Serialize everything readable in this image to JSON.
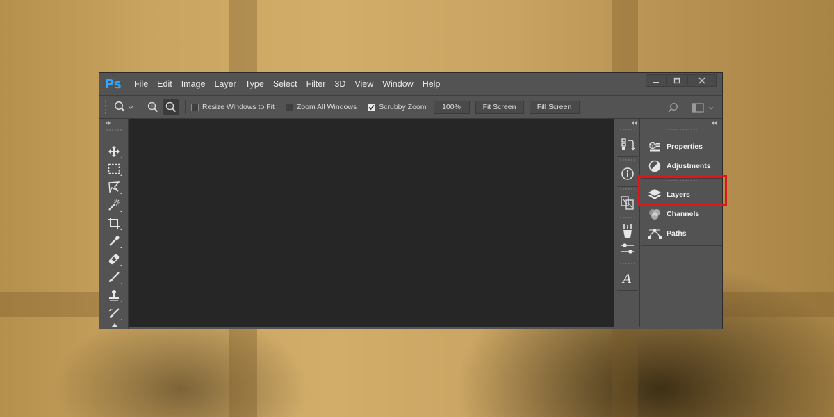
{
  "app": {
    "logo": "Ps",
    "menu": [
      "File",
      "Edit",
      "Image",
      "Layer",
      "Type",
      "Select",
      "Filter",
      "3D",
      "View",
      "Window",
      "Help"
    ],
    "window_controls": {
      "minimize_icon": "minimize-icon",
      "restore_icon": "restore-icon",
      "close_icon": "close-icon"
    }
  },
  "options_bar": {
    "resize_windows_label": "Resize Windows to Fit",
    "resize_windows_checked": false,
    "zoom_all_label": "Zoom All Windows",
    "zoom_all_checked": false,
    "scrubby_zoom_label": "Scrubby Zoom",
    "scrubby_zoom_checked": true,
    "zoom_value": "100%",
    "fit_screen_label": "Fit Screen",
    "fill_screen_label": "Fill Screen"
  },
  "tools": [
    "move-tool-icon",
    "marquee-tool-icon",
    "lasso-tool-icon",
    "magic-wand-tool-icon",
    "crop-tool-icon",
    "eyedropper-tool-icon",
    "healing-brush-tool-icon",
    "brush-tool-icon",
    "clone-stamp-tool-icon",
    "history-brush-tool-icon"
  ],
  "dock_icons": [
    "history-icon",
    "info-icon",
    "clone-source-icon",
    "brushes-icon",
    "brush-settings-icon",
    "character-icon"
  ],
  "panels": {
    "items": [
      {
        "label": "Properties",
        "icon": "properties-icon"
      },
      {
        "label": "Adjustments",
        "icon": "adjustments-icon"
      },
      {
        "label": "Layers",
        "icon": "layers-icon"
      },
      {
        "label": "Channels",
        "icon": "channels-icon"
      },
      {
        "label": "Paths",
        "icon": "paths-icon"
      }
    ]
  },
  "colors": {
    "highlight": "#e0141b",
    "ps_blue": "#31a8ff"
  }
}
